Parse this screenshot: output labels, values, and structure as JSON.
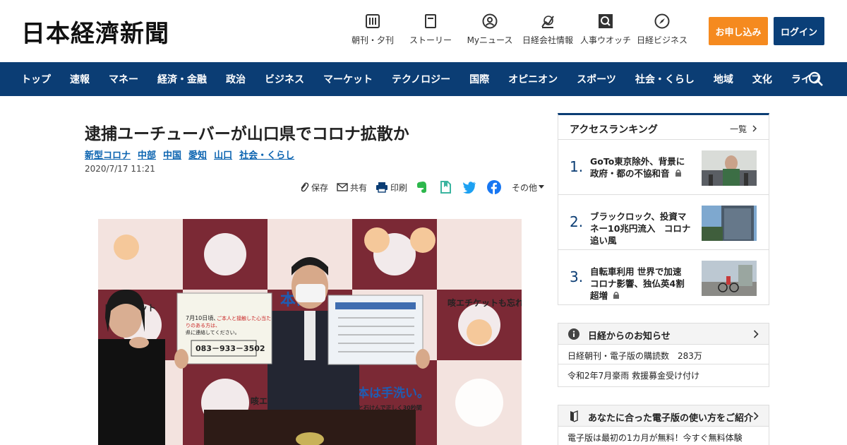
{
  "header": {
    "logo": "日本経濟新聞",
    "tools": [
      {
        "label": "朝刊・夕刊",
        "icon": "newspaper-icon"
      },
      {
        "label": "ストーリー",
        "icon": "document-icon"
      },
      {
        "label": "Myニュース",
        "icon": "user-icon"
      },
      {
        "label": "日経会社情報",
        "icon": "chart-icon"
      },
      {
        "label": "人事ウオッチ",
        "icon": "search-icon"
      },
      {
        "label": "日経ビジネス",
        "icon": "compass-icon"
      }
    ],
    "subscribe_label": "お申し込み",
    "login_label": "ログイン"
  },
  "nav": {
    "items": [
      "トップ",
      "速報",
      "マネー",
      "経済・金融",
      "政治",
      "ビジネス",
      "マーケット",
      "テクノロジー",
      "国際",
      "オピニオン",
      "スポーツ",
      "社会・くらし",
      "地域",
      "文化",
      "ライフ"
    ]
  },
  "article": {
    "title": "逮捕ユーチューバーが山口県でコロナ拡散か",
    "tags": [
      "新型コロナ",
      "中部",
      "中国",
      "愛知",
      "山口",
      "社会・くらし"
    ],
    "date": "2020/7/17 11:21",
    "share": {
      "save": "保存",
      "share": "共有",
      "print": "印刷",
      "other": "その他"
    },
    "photo_text": {
      "panel_left_top": "咳エチケット",
      "panel_right_top": "咳エチケットも忘れ",
      "panel_big": "本は",
      "panel_bottom": "基本は手洗い。",
      "panel_bottom_sub": "流水と石けんで正しく30秒間",
      "panel_bottom_left": "咳エ",
      "sign_left_date": "7月10日頃、",
      "sign_left_line1": "ご本人と接触した心当た",
      "sign_left_line2": "りのある方は、",
      "sign_left_line3": "県に連絡してください。",
      "sign_left_phone": "083－933－3502"
    }
  },
  "ranking": {
    "title": "アクセスランキング",
    "more": "一覧",
    "items": [
      {
        "rank": "1.",
        "text": "GoTo東京除外、背景に政府・都の不協和音"
      },
      {
        "rank": "2.",
        "text": "ブラックロック、投資マネー10兆円流入　コロナ追い風"
      },
      {
        "rank": "3.",
        "text": "自転車利用 世界で加速　コロナ影響、独仏英4割超増"
      }
    ]
  },
  "notice": {
    "title": "日経からのお知らせ",
    "rows": [
      "日経朝刊・電子版の購読数　283万",
      "令和2年7月豪雨 救援募金受け付け"
    ]
  },
  "guide": {
    "title": "あなたに合った電子版の使い方をご紹介",
    "rows": [
      "電子版は最初の1カ月が無料！今すぐ無料体験"
    ]
  },
  "colors": {
    "nav_bg": "#0b3d74",
    "subscribe_bg": "#f58a1f",
    "login_bg": "#0a3f78",
    "tag_link": "#0a63b0"
  }
}
